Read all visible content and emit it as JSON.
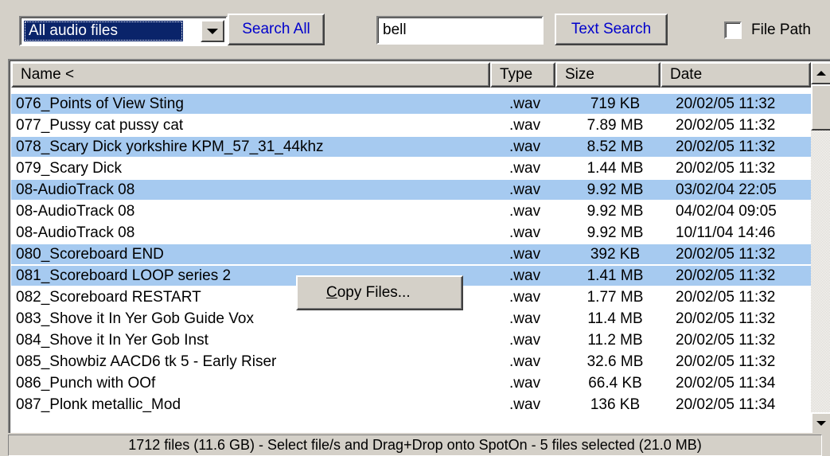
{
  "toolbar": {
    "filter_value": "All audio files",
    "search_all_label": "Search All",
    "search_text": "bell",
    "text_search_label": "Text Search",
    "file_path_label": "File Path",
    "file_path_checked": false
  },
  "columns": {
    "name": "Name <",
    "type": "Type",
    "size": "Size",
    "date": "Date"
  },
  "rows": [
    {
      "name": "076_Points of View Sting",
      "type": ".wav",
      "size": "719 KB",
      "date": "20/02/05 11:32",
      "selected": true
    },
    {
      "name": "077_Pussy cat pussy cat",
      "type": ".wav",
      "size": "7.89 MB",
      "date": "20/02/05 11:32",
      "selected": false
    },
    {
      "name": "078_Scary Dick yorkshire KPM_57_31_44khz",
      "type": ".wav",
      "size": "8.52 MB",
      "date": "20/02/05 11:32",
      "selected": true
    },
    {
      "name": "079_Scary Dick",
      "type": ".wav",
      "size": "1.44 MB",
      "date": "20/02/05 11:32",
      "selected": false
    },
    {
      "name": "08-AudioTrack 08",
      "type": ".wav",
      "size": "9.92 MB",
      "date": "03/02/04 22:05",
      "selected": true
    },
    {
      "name": "08-AudioTrack 08",
      "type": ".wav",
      "size": "9.92 MB",
      "date": "04/02/04 09:05",
      "selected": false
    },
    {
      "name": "08-AudioTrack 08",
      "type": ".wav",
      "size": "9.92 MB",
      "date": "10/11/04 14:46",
      "selected": false
    },
    {
      "name": "080_Scoreboard END",
      "type": ".wav",
      "size": "392 KB",
      "date": "20/02/05 11:32",
      "selected": true
    },
    {
      "name": "081_Scoreboard LOOP series 2",
      "type": ".wav",
      "size": "1.41 MB",
      "date": "20/02/05 11:32",
      "selected": true
    },
    {
      "name": "082_Scoreboard RESTART",
      "type": ".wav",
      "size": "1.77 MB",
      "date": "20/02/05 11:32",
      "selected": false
    },
    {
      "name": "083_Shove it In Yer Gob Guide Vox",
      "type": ".wav",
      "size": "11.4 MB",
      "date": "20/02/05 11:32",
      "selected": false
    },
    {
      "name": "084_Shove it In Yer Gob Inst",
      "type": ".wav",
      "size": "11.2 MB",
      "date": "20/02/05 11:32",
      "selected": false
    },
    {
      "name": "085_Showbiz AACD6 tk 5 - Early Riser",
      "type": ".wav",
      "size": "32.6 MB",
      "date": "20/02/05 11:32",
      "selected": false
    },
    {
      "name": "086_Punch with OOf",
      "type": ".wav",
      "size": "66.4 KB",
      "date": "20/02/05 11:34",
      "selected": false
    },
    {
      "name": "087_Plonk metallic_Mod",
      "type": ".wav",
      "size": "136 KB",
      "date": "20/02/05 11:34",
      "selected": false
    }
  ],
  "popup": {
    "label": "Copy Files...",
    "mnemonic": "C",
    "rest": "opy Files..."
  },
  "status": "1712 files (11.6 GB) - Select file/s and Drag+Drop onto SpotOn - 5 files selected (21.0 MB)",
  "colors": {
    "selection": "#a6caf0",
    "link_blue": "#0000cc",
    "face": "#d4d0c8"
  }
}
